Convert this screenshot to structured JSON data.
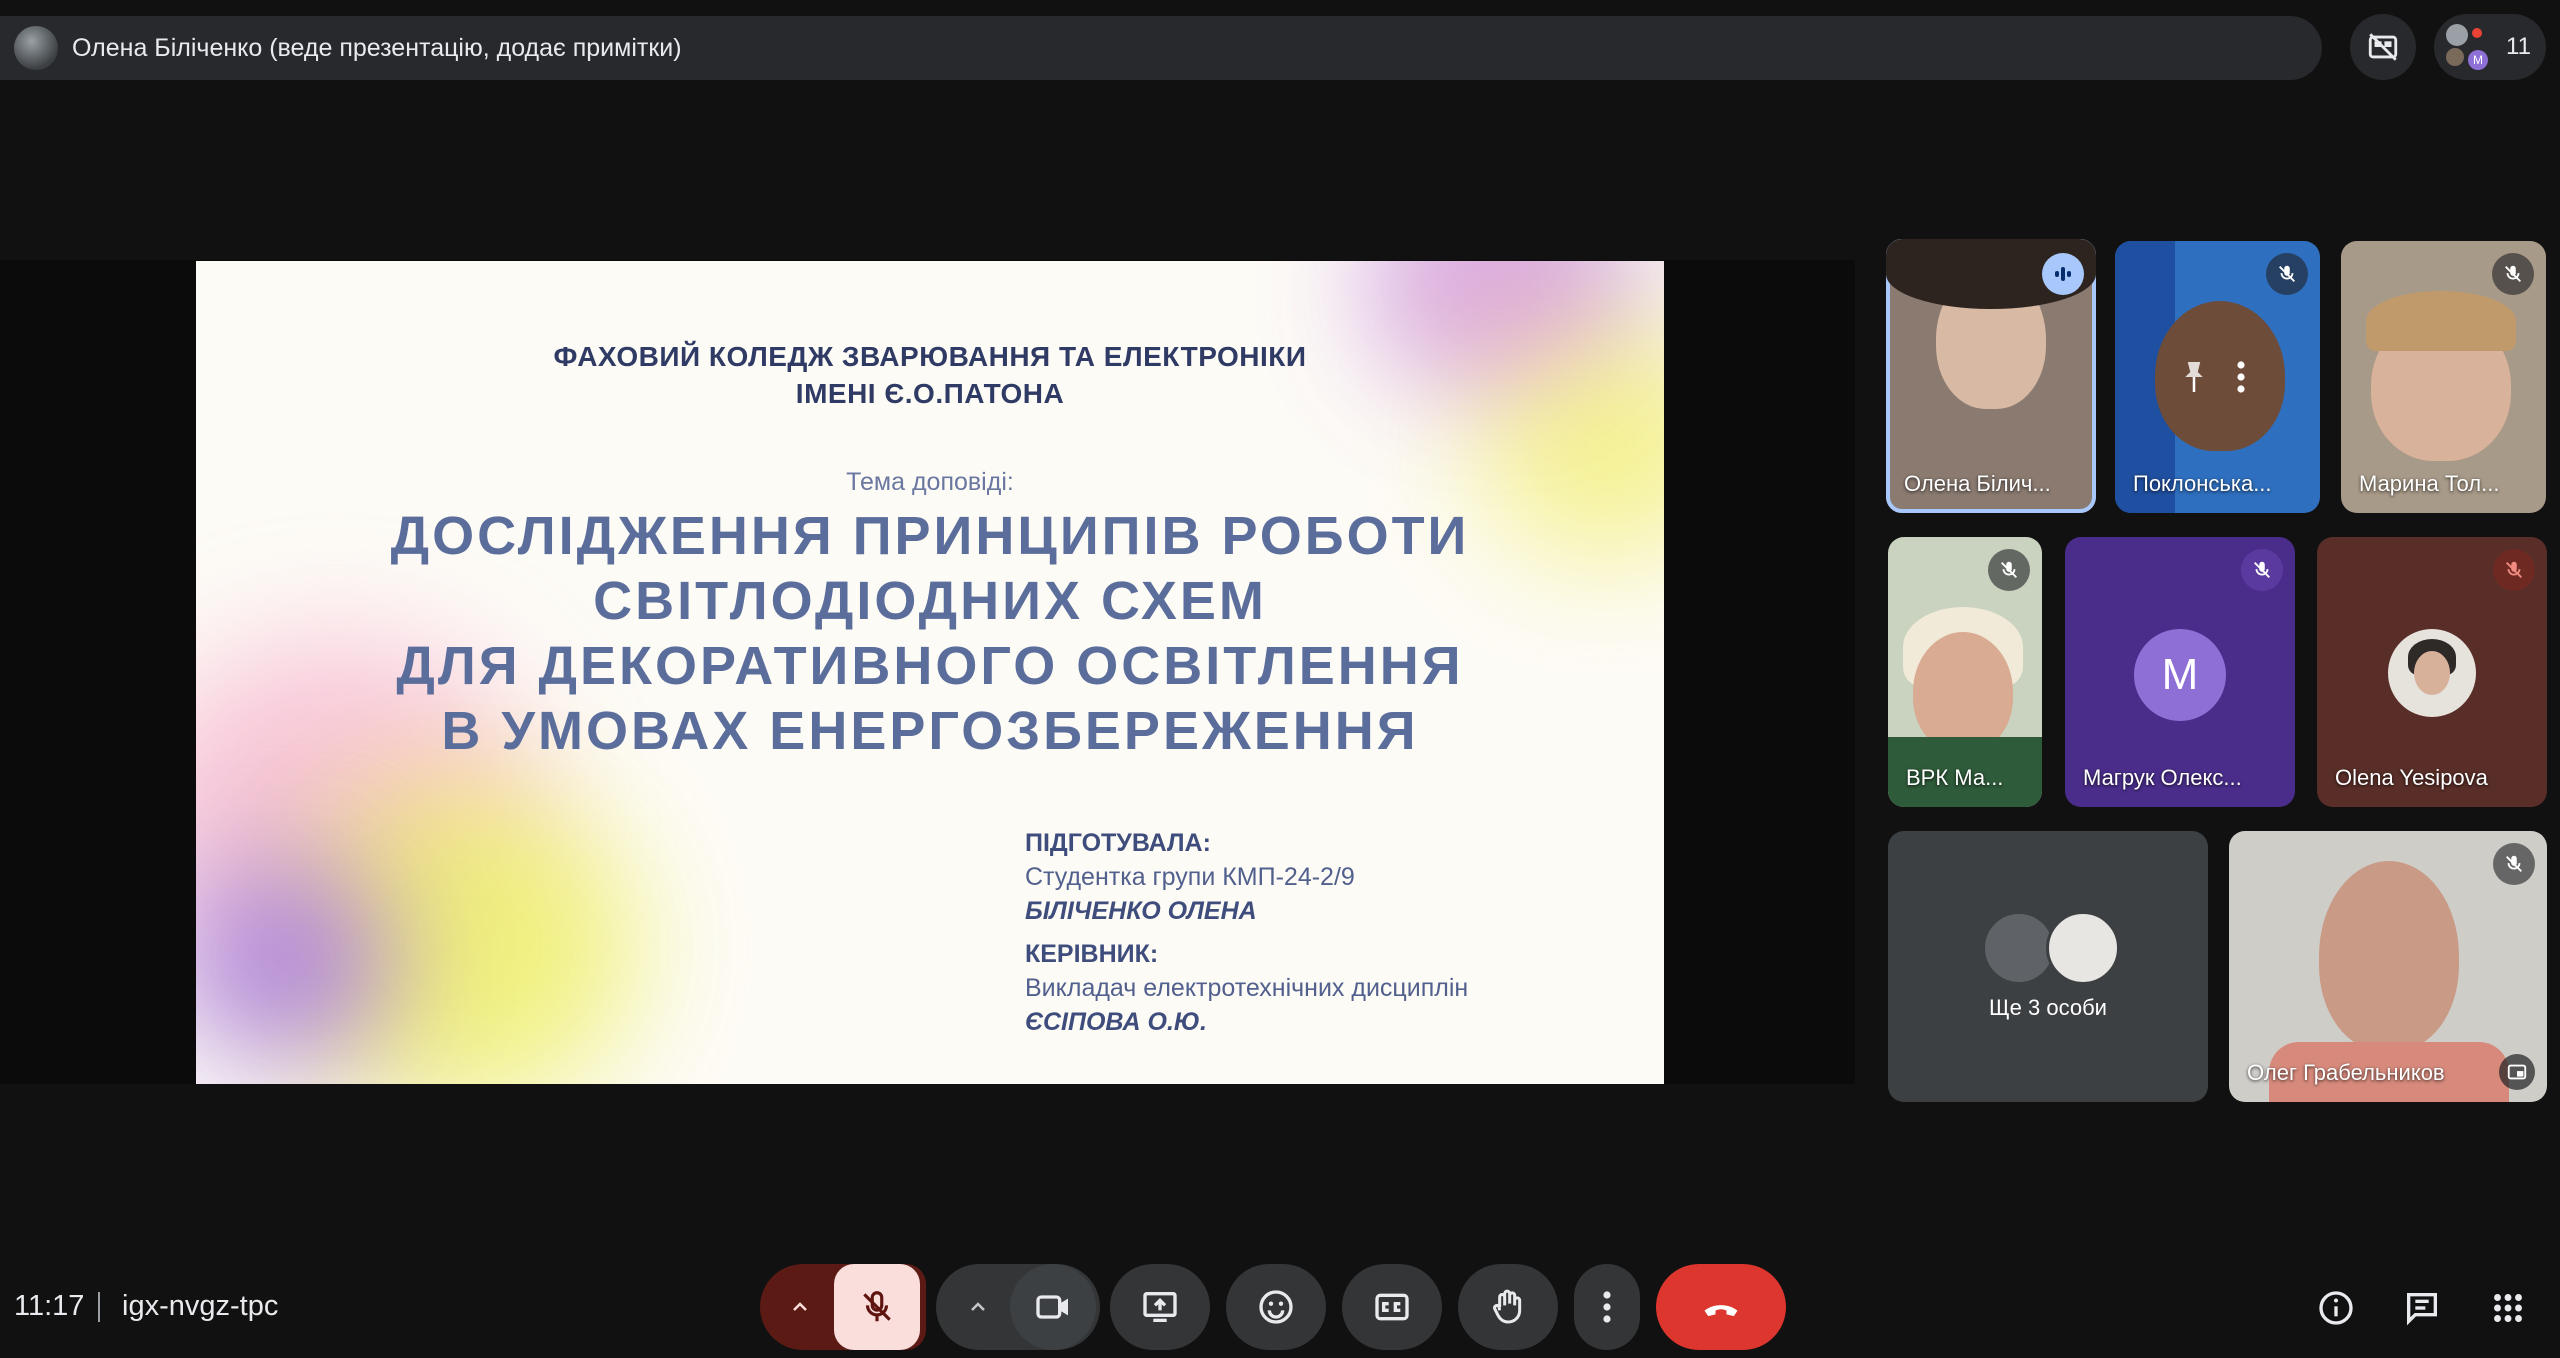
{
  "topbar": {
    "presenter_label": "Олена Біліченко (веде презентацію, додає примітки)",
    "participants_count": "11",
    "mini_avatar_letter": "M"
  },
  "slide": {
    "college_line1": "ФАХОВИЙ КОЛЕДЖ ЗВАРЮВАННЯ ТА ЕЛЕКТРОНІКИ",
    "college_line2": "ІМЕНІ Є.О.ПАТОНА",
    "topic_label": "Тема доповіді:",
    "title_lines": [
      "ДОСЛІДЖЕННЯ ПРИНЦИПІВ РОБОТИ",
      "СВІТЛОДІОДНИХ СХЕМ",
      "ДЛЯ ДЕКОРАТИВНОГО ОСВІТЛЕННЯ",
      "В УМОВАХ ЕНЕРГОЗБЕРЕЖЕННЯ"
    ],
    "prepared_heading": "ПІДГОТУВАЛА:",
    "prepared_desc": "Студентка групи КМП-24-2/9",
    "prepared_name": "БІЛІЧЕНКО ОЛЕНА",
    "supervisor_heading": "КЕРІВНИК:",
    "supervisor_desc": "Викладач електротехнічних дисциплін",
    "supervisor_name": "ЄСІПОВА О.Ю."
  },
  "participants": [
    {
      "name": "Олена Білич...",
      "state": "speaking"
    },
    {
      "name": "Поклонська...",
      "state": "muted"
    },
    {
      "name": "Марина Тол...",
      "state": "muted"
    },
    {
      "name": "ВРК Ма...",
      "state": "muted"
    },
    {
      "name": "Магрук Олекс...",
      "state": "muted",
      "avatar_letter": "M"
    },
    {
      "name": "Olena Yesipova",
      "state": "muted"
    },
    {
      "name": "Ще 3 особи",
      "state": "group"
    },
    {
      "name": "Олег Грабельников",
      "state": "muted"
    }
  ],
  "bottombar": {
    "time": "11:17",
    "meeting_code": "igx-nvgz-tpc"
  },
  "colors": {
    "background": "#111111",
    "mic_off_red": "#ea4335",
    "mic_caret_bg": "#5c1a15",
    "mic_btn_bg": "#f9dedc",
    "control_bg": "#333537",
    "selected_outline": "#a8c7fa",
    "slide_text": "#5b6d9b"
  }
}
